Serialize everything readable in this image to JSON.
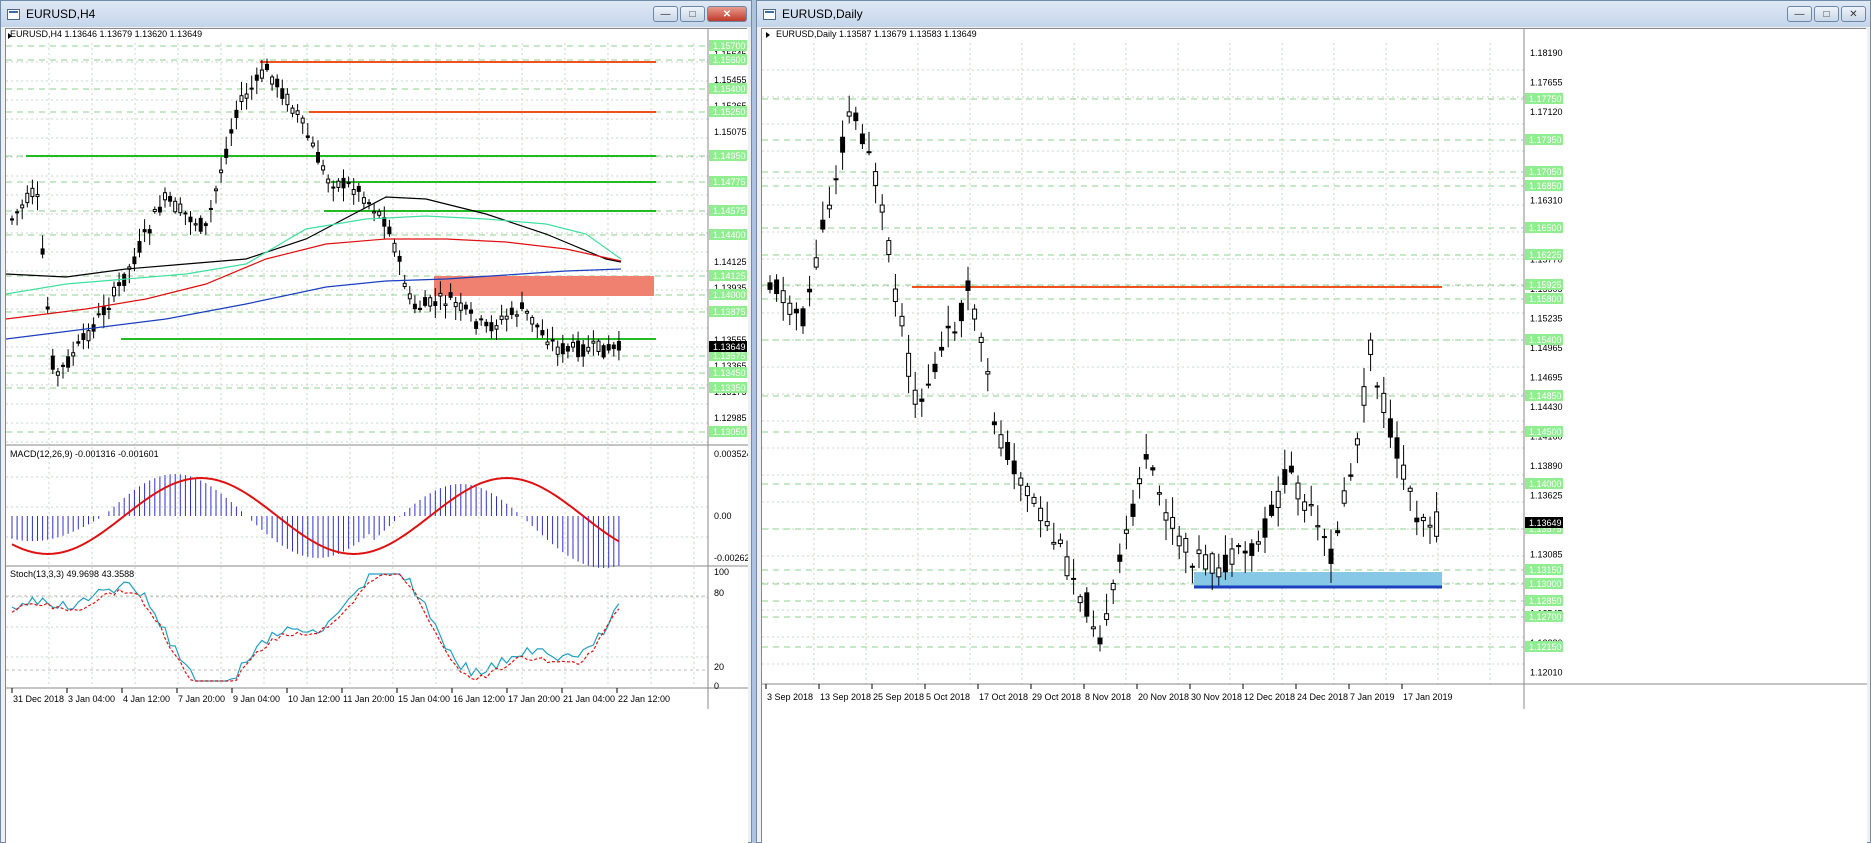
{
  "colors": {
    "bull": "#ffffff",
    "bear": "#000000",
    "grid": "#c9d6c9",
    "orange": "#f0501e",
    "green": "#22bb22",
    "zone_red": "#f08070",
    "zone_blue": "#87c8e6",
    "blue_line": "#1a3fc0",
    "price_tag_bg": "#000000",
    "level_tag_bg": "#90ee90",
    "macd_hist": "#3030d0",
    "macd_signal": "#e01010"
  },
  "left": {
    "window_title": "EURUSD,H4",
    "buttons": {
      "min": "—",
      "max": "□",
      "close": "✕"
    },
    "header": "EURUSD,H4  1.13646 1.13679 1.13620 1.13649",
    "current_price": "1.13649",
    "price_ticks": [
      "1.15645",
      "1.15455",
      "1.15265",
      "1.15075",
      "1.14885",
      "1.14695",
      "1.14505",
      "1.14315",
      "1.14125",
      "1.13935",
      "1.13745",
      "1.13555",
      "1.13365",
      "1.13175",
      "1.12985"
    ],
    "level_tags": [
      "1.15700",
      "1.15600",
      "1.15400",
      "1.15250",
      "1.14950",
      "1.14775",
      "1.14575",
      "1.14400",
      "1.14125",
      "1.14000",
      "1.13875",
      "1.13575",
      "1.13450",
      "1.13350",
      "1.13050"
    ],
    "macd_header": "MACD(12,26,9) -0.001316 -0.001601",
    "macd_ticks": [
      "0.003524",
      "0.00",
      "-0.002621"
    ],
    "stoch_header": "Stoch(13,3,3) 49.9698 43.3588",
    "stoch_ticks": [
      "100",
      "80",
      "20",
      "0"
    ],
    "time_labels": [
      "31 Dec 2018",
      "3 Jan 04:00",
      "4 Jan 12:00",
      "7 Jan 20:00",
      "9 Jan 04:00",
      "10 Jan 12:00",
      "11 Jan 20:00",
      "15 Jan 04:00",
      "16 Jan 12:00",
      "17 Jan 20:00",
      "21 Jan 04:00",
      "22 Jan 12:00"
    ]
  },
  "right": {
    "window_title": "EURUSD,Daily",
    "buttons": {
      "min": "—",
      "max": "□",
      "close": "✕"
    },
    "header": "EURUSD,Daily  1.13587 1.13679 1.13583 1.13649",
    "current_price": "1.13649",
    "price_ticks": [
      "1.18190",
      "1.17655",
      "1.17120",
      "1.16850",
      "1.16580",
      "1.16310",
      "1.16040",
      "1.15770",
      "1.15505",
      "1.15235",
      "1.14965",
      "1.14695",
      "1.14430",
      "1.14160",
      "1.13890",
      "1.13625",
      "1.13355",
      "1.13085",
      "1.12815",
      "1.12545",
      "1.12280",
      "1.12010"
    ],
    "level_tags": [
      "1.17750",
      "1.17350",
      "1.17050",
      "1.16850",
      "1.16500",
      "1.16225",
      "1.15925",
      "1.15800",
      "1.15400",
      "1.14850",
      "1.14500",
      "1.14000",
      "1.13575",
      "1.13150",
      "1.13000",
      "1.12850",
      "1.12700",
      "1.12150"
    ],
    "time_labels": [
      "3 Sep 2018",
      "13 Sep 2018",
      "25 Sep 2018",
      "5 Oct 2018",
      "17 Oct 2018",
      "29 Oct 2018",
      "8 Nov 2018",
      "20 Nov 2018",
      "30 Nov 2018",
      "12 Dec 2018",
      "24 Dec 2018",
      "7 Jan 2019",
      "17 Jan 2019"
    ]
  }
}
